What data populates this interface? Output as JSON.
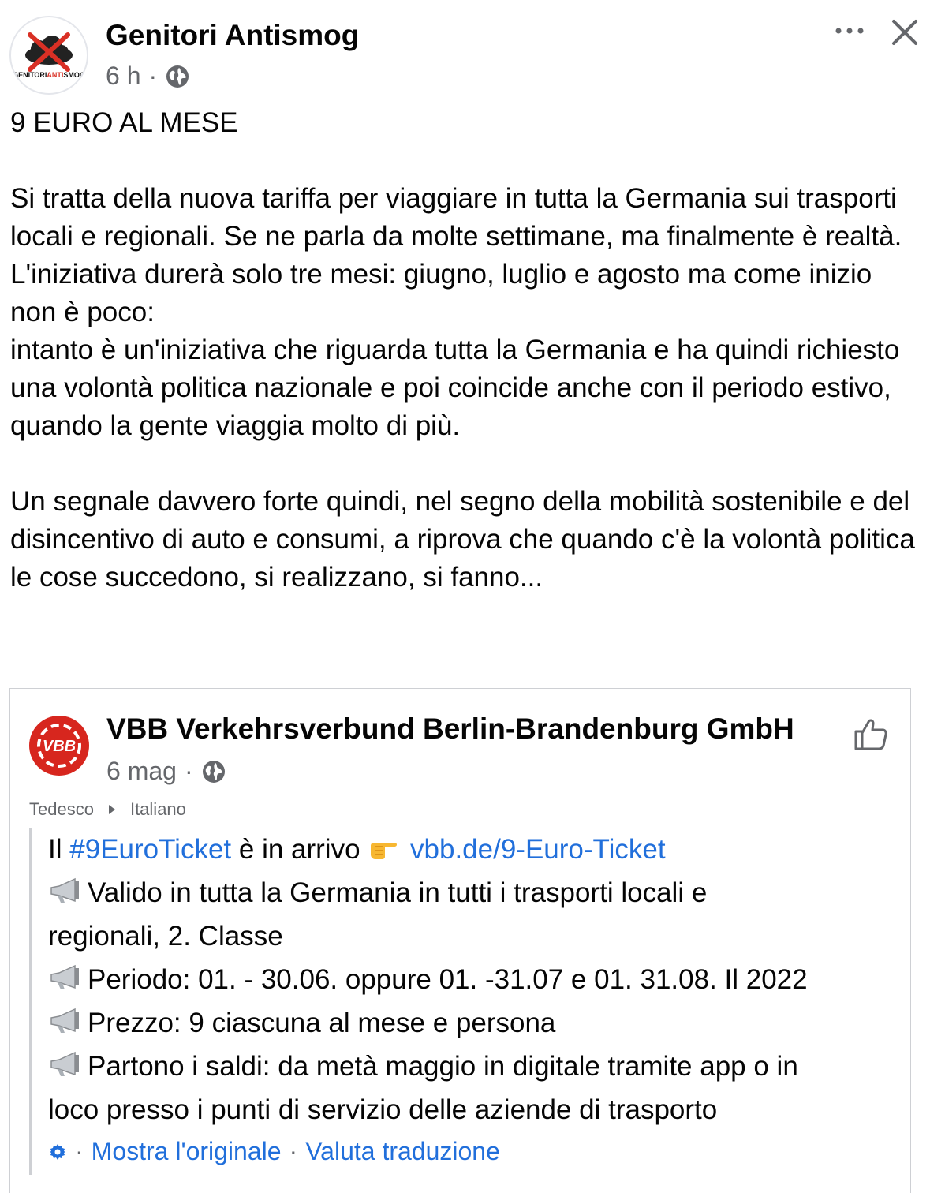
{
  "post": {
    "author": "Genitori Antismog",
    "avatar_text_black_1": "GENITORI",
    "avatar_text_red": "ANTI",
    "avatar_text_black_2": "SMOG",
    "time": "6 h",
    "more_icon": "more-dots-icon",
    "close_icon": "close-icon",
    "paragraphs": [
      "9 EURO AL MESE",
      "Si tratta della nuova tariffa per viaggiare in tutta la Germania sui trasporti locali e regionali. Se ne parla da molte settimane, ma finalmente è realtà.",
      "L'iniziativa durerà solo tre mesi: giugno, luglio e agosto ma come inizio non è poco:",
      "intanto è un'iniziativa che riguarda tutta la Germania e ha quindi richiesto una volontà politica nazionale e poi coincide anche con il periodo estivo, quando la gente viaggia molto di più.",
      "Un segnale davvero forte quindi, nel segno della mobilità sostenibile e del disincentivo di auto e consumi, a riprova che quando c'è la volontà politica le cose succedono, si realizzano, si fanno..."
    ]
  },
  "shared": {
    "logo_text": "VBB",
    "author": "VBB Verkehrsverbund Berlin-Brandenburg GmbH",
    "time": "6 mag",
    "source_lang": "Tedesco",
    "target_lang": "Italiano",
    "line1_prefix": "Il ",
    "hashtag": "#9EuroTicket",
    "line1_middle": " è in arrivo ",
    "link": "vbb.de/9-Euro-Ticket",
    "bullets": [
      "Valido in tutta la Germania in tutti i trasporti locali e",
      "Periodo: 01. - 30.06. oppure 01. -31.07 e 01. 31.08. Il 2022",
      "Prezzo: 9 ciascuna al mese e persona",
      "Partono i saldi: da metà maggio in digitale tramite app o in"
    ],
    "bullet1_cont": "regionali, 2. Classe",
    "bullet4_cont": "loco presso i punti di servizio delle aziende di trasporto",
    "show_original": "Mostra l'originale",
    "rate_translation": "Valuta traduzione",
    "colors": {
      "link": "#216fdb",
      "brand_red": "#d7261e",
      "meta": "#65676b"
    }
  }
}
